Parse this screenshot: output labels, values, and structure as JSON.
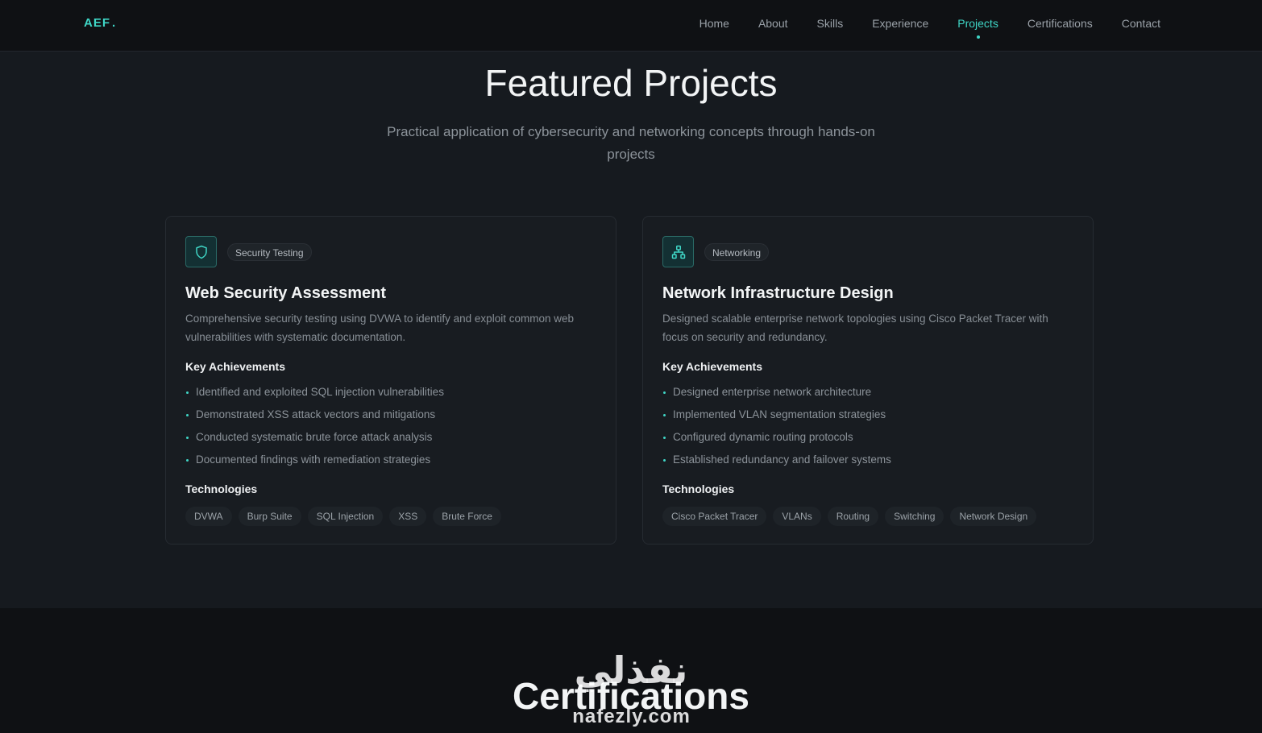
{
  "nav": {
    "logo": "AEF",
    "logo_dot": ".",
    "links": [
      "Home",
      "About",
      "Skills",
      "Experience",
      "Projects",
      "Certifications",
      "Contact"
    ],
    "active": "Projects"
  },
  "header": {
    "title": "Featured Projects",
    "subtitle": "Practical application of cybersecurity and networking concepts through hands-on projects"
  },
  "projects": [
    {
      "icon": "shield-icon",
      "category": "Security Testing",
      "title": "Web Security Assessment",
      "description": "Comprehensive security testing using DVWA to identify and exploit common web vulnerabilities with systematic documentation.",
      "achievements_heading": "Key Achievements",
      "achievements": [
        "Identified and exploited SQL injection vulnerabilities",
        "Demonstrated XSS attack vectors and mitigations",
        "Conducted systematic brute force attack analysis",
        "Documented findings with remediation strategies"
      ],
      "technologies_heading": "Technologies",
      "technologies": [
        "DVWA",
        "Burp Suite",
        "SQL Injection",
        "XSS",
        "Brute Force"
      ]
    },
    {
      "icon": "network-icon",
      "category": "Networking",
      "title": "Network Infrastructure Design",
      "description": "Designed scalable enterprise network topologies using Cisco Packet Tracer with focus on security and redundancy.",
      "achievements_heading": "Key Achievements",
      "achievements": [
        "Designed enterprise network architecture",
        "Implemented VLAN segmentation strategies",
        "Configured dynamic routing protocols",
        "Established redundancy and failover systems"
      ],
      "technologies_heading": "Technologies",
      "technologies": [
        "Cisco Packet Tracer",
        "VLANs",
        "Routing",
        "Switching",
        "Network Design"
      ]
    }
  ],
  "next_section": {
    "title": "Certifications"
  },
  "watermark": {
    "arabic": "نفذلي",
    "latin": "nafezly.com"
  },
  "colors": {
    "accent": "#3fd6c6",
    "background": "#161a1f",
    "nav_bg": "#0f1114",
    "card_bg": "#181c21"
  }
}
